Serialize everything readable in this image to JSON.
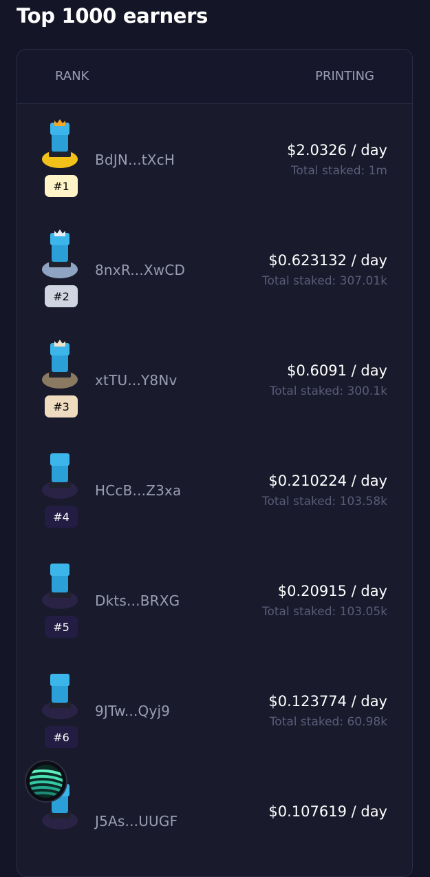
{
  "page": {
    "title": "Top 1000 earners"
  },
  "table": {
    "header_rank": "RANK",
    "header_printing": "PRINTING",
    "rows": [
      {
        "rank": "#1",
        "wallet": "BdJN...tXcH",
        "rate": "$2.0326 / day",
        "staked": "Total staked: 1m",
        "pedestal_color": "#f2c21b",
        "badge_bg": "#fff4c8",
        "badge_text": "#000000",
        "crown_color": "#f5a623",
        "variant": "crowned"
      },
      {
        "rank": "#2",
        "wallet": "8nxR...XwCD",
        "rate": "$0.623132 / day",
        "staked": "Total staked: 307.01k",
        "pedestal_color": "#8fa4c2",
        "badge_bg": "#cfd6e2",
        "badge_text": "#000000",
        "crown_color": "#e8ecf3",
        "variant": "crowned"
      },
      {
        "rank": "#3",
        "wallet": "xtTU...Y8Nv",
        "rate": "$0.6091 / day",
        "staked": "Total staked: 300.1k",
        "pedestal_color": "#8a7a62",
        "badge_bg": "#efdcc0",
        "badge_text": "#000000",
        "crown_color": "#f1e3c8",
        "variant": "crowned"
      },
      {
        "rank": "#4",
        "wallet": "HCcB...Z3xa",
        "rate": "$0.210224 / day",
        "staked": "Total staked: 103.58k",
        "pedestal_color": "#2a2346",
        "badge_bg": "#231d43",
        "badge_text": "#ffffff",
        "crown_color": "",
        "variant": "plain"
      },
      {
        "rank": "#5",
        "wallet": "Dkts...BRXG",
        "rate": "$0.20915 / day",
        "staked": "Total staked: 103.05k",
        "pedestal_color": "#2a2346",
        "badge_bg": "#231d43",
        "badge_text": "#ffffff",
        "crown_color": "",
        "variant": "plain"
      },
      {
        "rank": "#6",
        "wallet": "9JTw...Qyj9",
        "rate": "$0.123774 / day",
        "staked": "Total staked: 60.98k",
        "pedestal_color": "#2a2346",
        "badge_bg": "#231d43",
        "badge_text": "#ffffff",
        "crown_color": "",
        "variant": "plain"
      },
      {
        "rank": "",
        "wallet": "J5As...UUGF",
        "rate": "$0.107619 / day",
        "staked": "",
        "pedestal_color": "#2a2346",
        "badge_bg": "#231d43",
        "badge_text": "#ffffff",
        "crown_color": "",
        "variant": "plain"
      }
    ]
  },
  "theme": {
    "background": "#141526",
    "panel": "#191a2c",
    "muted_text": "#9b9db3",
    "dim_text": "#5a5c78"
  },
  "icons": {
    "fab": "striped-sphere-icon",
    "avatar": "robot-character-icon"
  }
}
